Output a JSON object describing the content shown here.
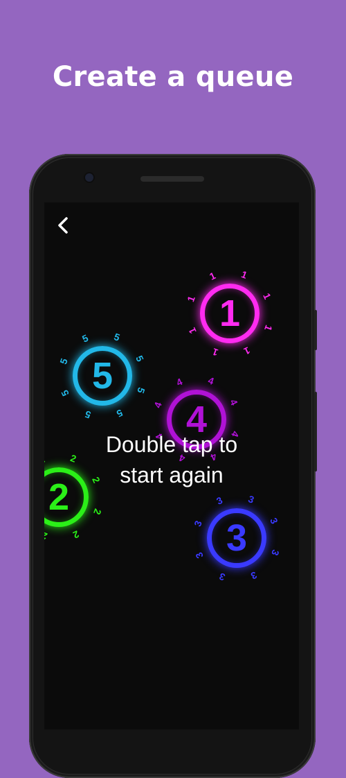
{
  "headline": "Create a queue",
  "back_icon": "chevron-left-icon",
  "prompt_line1": "Double tap to",
  "prompt_line2": "start again",
  "touches": [
    {
      "label": "1",
      "color": "#ff2bf0"
    },
    {
      "label": "5",
      "color": "#22b8e8"
    },
    {
      "label": "4",
      "color": "#b012d6"
    },
    {
      "label": "2",
      "color": "#2bef18"
    },
    {
      "label": "3",
      "color": "#3a3aff"
    }
  ],
  "colors": {
    "background": "#9466c0",
    "screen": "#0b0b0b"
  }
}
